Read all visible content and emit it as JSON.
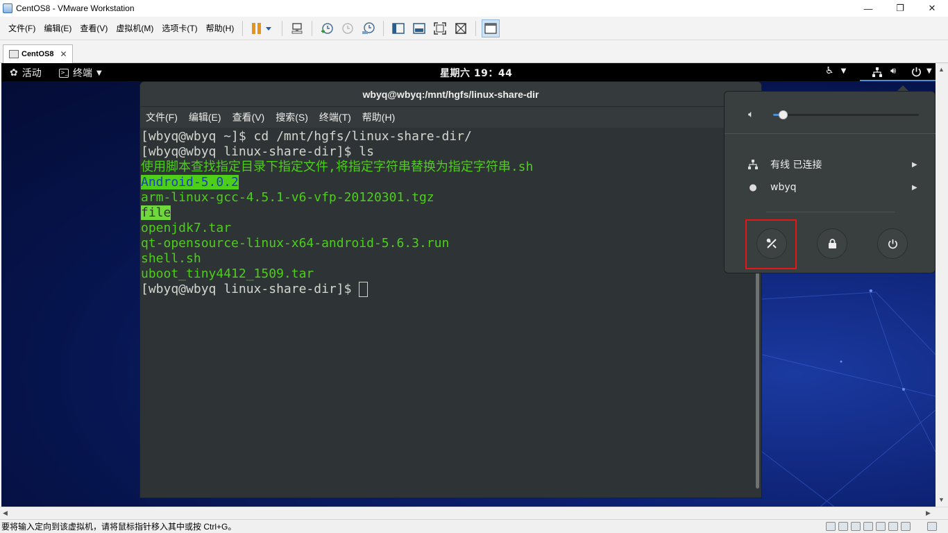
{
  "window": {
    "title": "CentOS8 - VMware Workstation",
    "min": "—",
    "max": "❐",
    "close": "✕"
  },
  "vmware_menu": [
    "文件(F)",
    "编辑(E)",
    "查看(V)",
    "虚拟机(M)",
    "选项卡(T)",
    "帮助(H)"
  ],
  "tab": {
    "label": "CentOS8",
    "close": "✕"
  },
  "gnome": {
    "activities": "活动",
    "app_menu": "终端",
    "clock": "星期六 19：44"
  },
  "terminal": {
    "title": "wbyq@wbyq:/mnt/hgfs/linux-share-dir",
    "menus": [
      "文件(F)",
      "编辑(E)",
      "查看(V)",
      "搜索(S)",
      "终端(T)",
      "帮助(H)"
    ],
    "lines": [
      {
        "text": "[wbyq@wbyq ~]$ cd /mnt/hgfs/linux-share-dir/",
        "style": "prompt"
      },
      {
        "text": "[wbyq@wbyq linux-share-dir]$ ls",
        "style": "prompt"
      },
      {
        "text": "使用脚本查找指定目录下指定文件,将指定字符串替换为指定字符串.sh",
        "style": "green"
      },
      {
        "text": "Android-5.0.2",
        "style": "hl"
      },
      {
        "text": "arm-linux-gcc-4.5.1-v6-vfp-20120301.tgz",
        "style": "green"
      },
      {
        "text": "file",
        "style": "hl-dark"
      },
      {
        "text": "openjdk7.tar",
        "style": "green"
      },
      {
        "text": "qt-opensource-linux-x64-android-5.6.3.run",
        "style": "green"
      },
      {
        "text": "shell.sh",
        "style": "green"
      },
      {
        "text": "uboot_tiny4412_1509.tar",
        "style": "green"
      }
    ],
    "last_prompt": "[wbyq@wbyq linux-share-dir]$ "
  },
  "system_menu": {
    "volume_percent": 5,
    "network_label": "有线 已连接",
    "user_label": "wbyq"
  },
  "status_bar": {
    "message": "要将输入定向到该虚拟机，请将鼠标指针移入其中或按 Ctrl+G。"
  },
  "colors": {
    "terminal_bg": "#2e3436",
    "ls_green": "#4dcf19",
    "highlight_box": "#e41616",
    "accent": "#4a90d9"
  }
}
